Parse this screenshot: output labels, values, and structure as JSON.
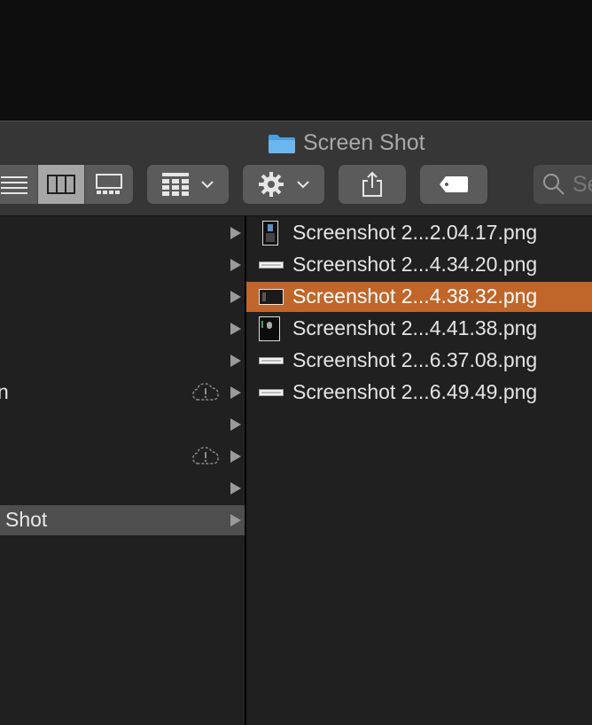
{
  "window": {
    "title": "Screen Shot",
    "title_icon": "folder-icon"
  },
  "toolbar": {
    "view_icons": [
      "list-view-icon",
      "column-view-icon",
      "gallery-view-icon"
    ],
    "group_icon": "group-by-icon",
    "action_icon": "gear-icon",
    "share_icon": "share-icon",
    "tag_icon": "tag-icon",
    "search_placeholder": "Se"
  },
  "left_column": {
    "rows": [
      {
        "label": ""
      },
      {
        "label": ""
      },
      {
        "label": ""
      },
      {
        "label": ""
      },
      {
        "label": ""
      },
      {
        "label": "n",
        "status_icon": "cloud-alert-icon"
      },
      {
        "label": ""
      },
      {
        "label": "",
        "status_icon": "cloud-alert-icon"
      },
      {
        "label": ""
      },
      {
        "label": "Shot",
        "selected": true
      }
    ]
  },
  "files": [
    {
      "name": "Screenshot 2...2.04.17.png",
      "thumb": "portrait"
    },
    {
      "name": "Screenshot 2...4.34.20.png",
      "thumb": "bar"
    },
    {
      "name": "Screenshot 2...4.38.32.png",
      "thumb": "dark",
      "selected": true
    },
    {
      "name": "Screenshot 2...4.41.38.png",
      "thumb": "portrait-dark"
    },
    {
      "name": "Screenshot 2...6.37.08.png",
      "thumb": "bar"
    },
    {
      "name": "Screenshot 2...6.49.49.png",
      "thumb": "bar"
    }
  ],
  "colors": {
    "selection_accent": "#c0662a",
    "folder_blue": "#4a9fe0"
  }
}
